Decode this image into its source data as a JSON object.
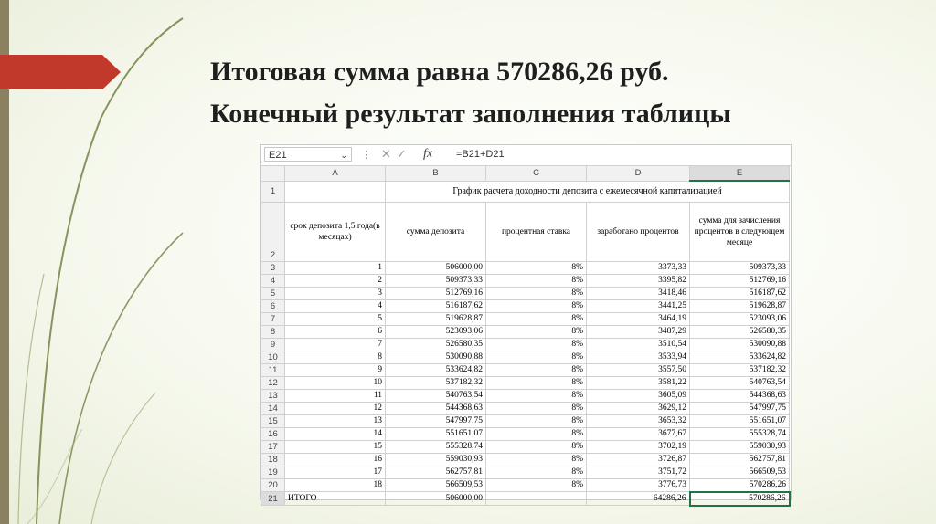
{
  "slide": {
    "title_line1": "Итоговая сумма равна 570286,26 руб.",
    "title_line2": "Конечный результат заполнения таблицы"
  },
  "excel": {
    "name_box": "E21",
    "fx_label": "fx",
    "formula": "=B21+D21",
    "columns": [
      "A",
      "B",
      "C",
      "D",
      "E"
    ],
    "table_title": "График расчета доходности депозита с ежемесячной капитализацией",
    "headers": [
      "срок депозита 1,5 года(в месяцах)",
      "сумма депозита",
      "процентная ставка",
      "заработано процентов",
      "сумма для зачисления процентов в следующем месяце"
    ],
    "rows": [
      {
        "rn": "3",
        "a": "1",
        "b": "506000,00",
        "c": "8%",
        "d": "3373,33",
        "e": "509373,33"
      },
      {
        "rn": "4",
        "a": "2",
        "b": "509373,33",
        "c": "8%",
        "d": "3395,82",
        "e": "512769,16"
      },
      {
        "rn": "5",
        "a": "3",
        "b": "512769,16",
        "c": "8%",
        "d": "3418,46",
        "e": "516187,62"
      },
      {
        "rn": "6",
        "a": "4",
        "b": "516187,62",
        "c": "8%",
        "d": "3441,25",
        "e": "519628,87"
      },
      {
        "rn": "7",
        "a": "5",
        "b": "519628,87",
        "c": "8%",
        "d": "3464,19",
        "e": "523093,06"
      },
      {
        "rn": "8",
        "a": "6",
        "b": "523093,06",
        "c": "8%",
        "d": "3487,29",
        "e": "526580,35"
      },
      {
        "rn": "9",
        "a": "7",
        "b": "526580,35",
        "c": "8%",
        "d": "3510,54",
        "e": "530090,88"
      },
      {
        "rn": "10",
        "a": "8",
        "b": "530090,88",
        "c": "8%",
        "d": "3533,94",
        "e": "533624,82"
      },
      {
        "rn": "11",
        "a": "9",
        "b": "533624,82",
        "c": "8%",
        "d": "3557,50",
        "e": "537182,32"
      },
      {
        "rn": "12",
        "a": "10",
        "b": "537182,32",
        "c": "8%",
        "d": "3581,22",
        "e": "540763,54"
      },
      {
        "rn": "13",
        "a": "11",
        "b": "540763,54",
        "c": "8%",
        "d": "3605,09",
        "e": "544368,63"
      },
      {
        "rn": "14",
        "a": "12",
        "b": "544368,63",
        "c": "8%",
        "d": "3629,12",
        "e": "547997,75"
      },
      {
        "rn": "15",
        "a": "13",
        "b": "547997,75",
        "c": "8%",
        "d": "3653,32",
        "e": "551651,07"
      },
      {
        "rn": "16",
        "a": "14",
        "b": "551651,07",
        "c": "8%",
        "d": "3677,67",
        "e": "555328,74"
      },
      {
        "rn": "17",
        "a": "15",
        "b": "555328,74",
        "c": "8%",
        "d": "3702,19",
        "e": "559030,93"
      },
      {
        "rn": "18",
        "a": "16",
        "b": "559030,93",
        "c": "8%",
        "d": "3726,87",
        "e": "562757,81"
      },
      {
        "rn": "19",
        "a": "17",
        "b": "562757,81",
        "c": "8%",
        "d": "3751,72",
        "e": "566509,53"
      },
      {
        "rn": "20",
        "a": "18",
        "b": "566509,53",
        "c": "8%",
        "d": "3776,73",
        "e": "570286,26"
      }
    ],
    "total_row": {
      "rn": "21",
      "a": "ИТОГО",
      "b": "506000,00",
      "c": "",
      "d": "64286,26",
      "e": "570286,26"
    }
  }
}
